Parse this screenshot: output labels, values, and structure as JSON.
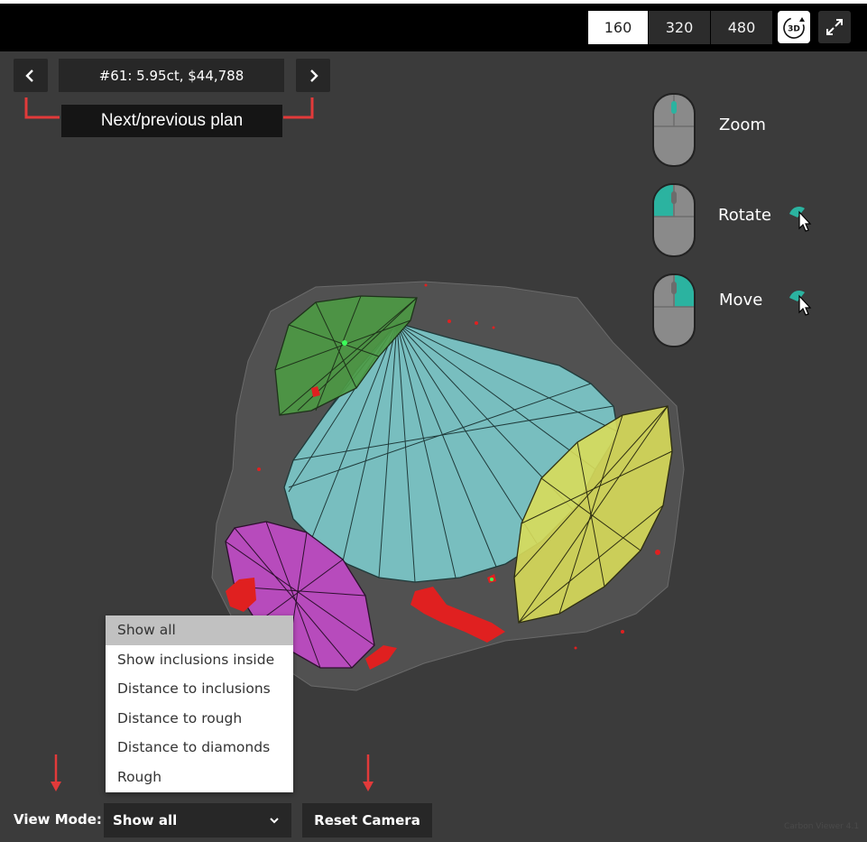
{
  "toolbar": {
    "sizes": [
      "160",
      "320",
      "480"
    ],
    "selected_size": "160",
    "view3d_label": "3D"
  },
  "plan_nav": {
    "title": "#61: 5.95ct, $44,788",
    "caption": "Next/previous plan"
  },
  "mouse_controls": {
    "zoom_label": "Zoom",
    "rotate_label": "Rotate",
    "move_label": "Move"
  },
  "view_mode": {
    "label": "View Mode:",
    "selected": "Show all",
    "options": [
      "Show all",
      "Show inclusions inside",
      "Distance to inclusions",
      "Distance to rough",
      "Distance to diamonds",
      "Rough"
    ]
  },
  "reset_camera_label": "Reset Camera",
  "version": "Carbon Viewer 4.1",
  "colors": {
    "accent_teal": "#2bb3a0",
    "annotation_red": "#e23a3a",
    "stone_cyan": "#7fd1d2",
    "stone_yellow": "#d8dc5a",
    "stone_magenta": "#c24ac8",
    "stone_green": "#4c9a44",
    "inclusion_red": "#e02020"
  }
}
